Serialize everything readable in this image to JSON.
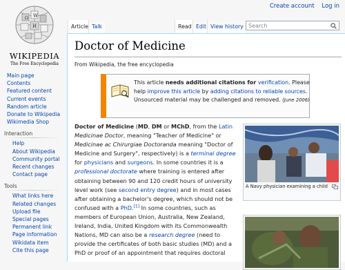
{
  "personal_tools": {
    "create_account": "Create account",
    "log_in": "Log in"
  },
  "logo": {
    "wordmark": "WIKIPEDIA",
    "tagline": "The Free Encyclopedia"
  },
  "sidebar": {
    "main": [
      "Main page",
      "Contents",
      "Featured content",
      "Current events",
      "Random article",
      "Donate to Wikipedia",
      "Wikimedia Shop"
    ],
    "interaction_heading": "Interaction",
    "interaction": [
      "Help",
      "About Wikipedia",
      "Community portal",
      "Recent changes",
      "Contact page"
    ],
    "tools_heading": "Tools",
    "tools": [
      "What links here",
      "Related changes",
      "Upload file",
      "Special pages",
      "Permanent link",
      "Page information",
      "Wikidata item",
      "Cite this page"
    ]
  },
  "tabs": {
    "article": "Article",
    "talk": "Talk",
    "read": "Read",
    "edit": "Edit",
    "history": "View history"
  },
  "search": {
    "placeholder": "Search"
  },
  "page": {
    "title": "Doctor of Medicine",
    "tagline": "From Wikipedia, the free encyclopedia"
  },
  "ambox": {
    "t1": "This article ",
    "t2": "needs additional citations for ",
    "t3": "verification",
    "t4": ". Please help ",
    "t5": "improve this article",
    "t6": " by ",
    "t7": "adding citations to reliable sources",
    "t8": ". Unsourced material may be challenged and removed.",
    "date": "(June 2006)"
  },
  "para": {
    "p01": "Doctor of Medicine",
    "p02": " (",
    "p03": "MD",
    "p04": ", ",
    "p05": "DM",
    "p06": " or ",
    "p07": "MChD",
    "p08": ", from the ",
    "p09": "Latin",
    "p10": "Medicinae Doctor",
    "p11": ", meaning \"Teacher of Medicine\" or ",
    "p12": "Medicinae ac Chirurgiae Doctoranda",
    "p13": " meaning \"Doctor of Medicine and Surgery\", respectively) is a ",
    "p14": "terminal degree",
    "p15": " for ",
    "p16": "physicians",
    "p17": " and ",
    "p18": "surgeons",
    "p19": ". In some countries it is a ",
    "p20": "professional doctorate",
    "p21": " where training is entered after obtaining between 90 and 120 credit hours of university level work (see ",
    "p22": "second entry degree",
    "p23": ") and in most cases after obtaining a bachelor's degree, which should not be confused with a ",
    "p24": "PhD",
    "p25": ".",
    "p26": "[1]",
    "p27": " In some countries, such as members of European Union, Australia, New Zealand, Ireland, India, United Kingdom with its Commonwealth Nations, MD can also be a ",
    "p28": "research degree",
    "p29": " (need to provide the certificates of both basic studies (MD) and a PhD or proof of an appointment that requires doctoral"
  },
  "thumb1": {
    "caption": "A Navy physician examining a child"
  },
  "colors": {
    "link": "#0645ad",
    "ambox_border": "#f28500",
    "content_border": "#a7d7f9"
  },
  "icons": [
    "search-icon",
    "book-icon",
    "globe-logo",
    "magnify-icon"
  ]
}
